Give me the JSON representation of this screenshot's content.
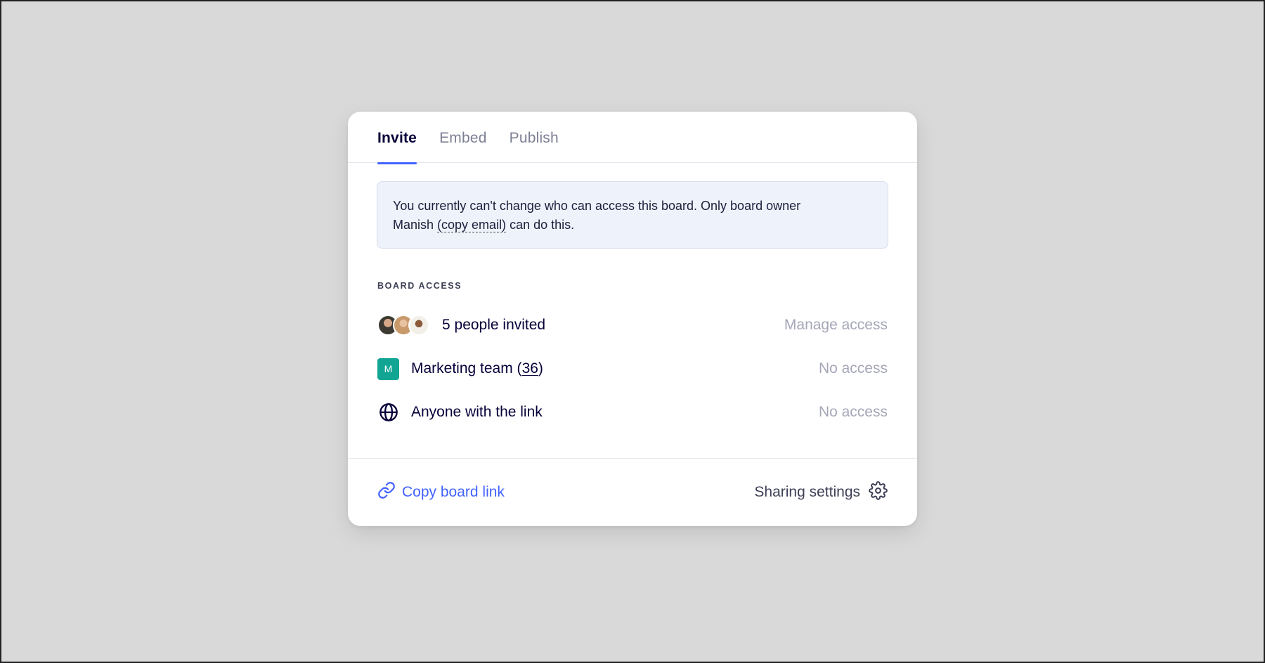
{
  "tabs": [
    {
      "label": "Invite",
      "active": true
    },
    {
      "label": "Embed",
      "active": false
    },
    {
      "label": "Publish",
      "active": false
    }
  ],
  "notice": {
    "line1": "You currently can't change who can access this board. Only board owner",
    "line2_prefix": "Manish ",
    "link": "(copy email)",
    "line2_suffix": " can do this."
  },
  "board_access": {
    "label": "BOARD ACCESS",
    "rows": [
      {
        "icon": "avatar-stack",
        "text": "5 people invited",
        "action": "Manage access"
      },
      {
        "icon": "team-badge",
        "badge_letter": "M",
        "text_prefix": "Marketing team (",
        "count": "36",
        "text_suffix": ")",
        "action": "No access"
      },
      {
        "icon": "globe-icon",
        "text": "Anyone with the link",
        "action": "No access"
      }
    ]
  },
  "footer": {
    "copy_link": "Copy board link",
    "sharing_settings": "Sharing settings"
  },
  "colors": {
    "accent": "#4262ff",
    "team_badge": "#12a594",
    "text_primary": "#050038",
    "text_muted": "#a5a7b8"
  }
}
